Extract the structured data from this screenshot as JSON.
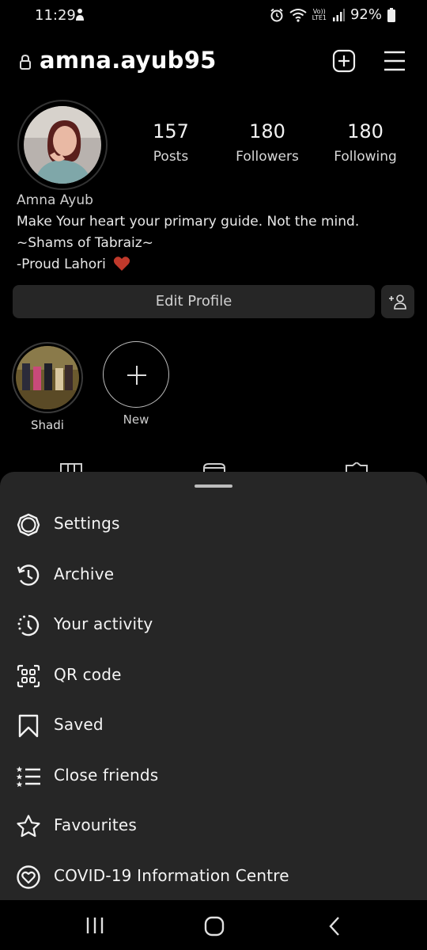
{
  "status_bar": {
    "time": "11:29",
    "battery": "92%",
    "network_top": "Vo))",
    "network_bottom": "LTE1"
  },
  "header": {
    "username": "amna.ayub95"
  },
  "profile": {
    "stats": [
      {
        "value": "157",
        "label": "Posts"
      },
      {
        "value": "180",
        "label": "Followers"
      },
      {
        "value": "180",
        "label": "Following"
      }
    ],
    "bio": {
      "name": "Amna Ayub",
      "line1": "Make Your heart your primary guide. Not the mind.",
      "line2": "~Shams of Tabraiz~",
      "line3": "-Proud Lahori"
    },
    "edit_profile_label": "Edit Profile"
  },
  "highlights": {
    "items": [
      {
        "label": "Shadi"
      }
    ],
    "new_label": "New"
  },
  "menu": {
    "items": [
      {
        "label": "Settings",
        "icon": "settings-icon"
      },
      {
        "label": "Archive",
        "icon": "archive-icon"
      },
      {
        "label": "Your activity",
        "icon": "activity-icon"
      },
      {
        "label": "QR code",
        "icon": "qr-code-icon"
      },
      {
        "label": "Saved",
        "icon": "saved-icon"
      },
      {
        "label": "Close friends",
        "icon": "close-friends-icon"
      },
      {
        "label": "Favourites",
        "icon": "favourites-icon"
      },
      {
        "label": "COVID-19 Information Centre",
        "icon": "covid-info-icon"
      }
    ]
  },
  "colors": {
    "background": "#000000",
    "sheet": "#262626",
    "button": "#262626",
    "heart": "#c0392b"
  }
}
